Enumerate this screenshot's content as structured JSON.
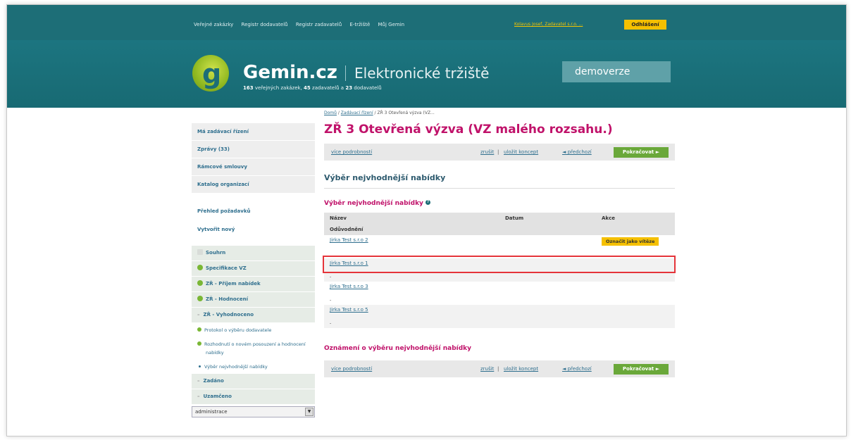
{
  "topbar": {
    "nav": [
      "Veřejné zakázky",
      "Registr dodavatelů",
      "Registr zadavatelů",
      "E-tržiště",
      "Můj Gemin"
    ],
    "user": "Kolavus Josef, Zadavatel s.r.o. ...",
    "logout": "Odhlášení"
  },
  "header": {
    "name": "Gemin.cz",
    "subtitle": "Elektronické tržiště",
    "stats_n1": "163",
    "stats_t1": " veřejných zakázek, ",
    "stats_n2": "45",
    "stats_t2": " zadavatelů a ",
    "stats_n3": "23",
    "stats_t3": " dodavatelů",
    "demo": "demoverze"
  },
  "sidebar": {
    "boxes": [
      "Má zadávací řízení",
      "Zprávy (33)",
      "Rámcové smlouvy",
      "Katalog organizací"
    ],
    "links": [
      "Přehled požadavků",
      "Vytvořit nový"
    ],
    "steps": [
      "Souhrn",
      "Specifikace VZ",
      "ZŘ - Příjem nabídek",
      "ZŘ - Hodnocení",
      "ZŘ - Vyhodnoceno"
    ],
    "substeps": [
      "Protokol o výběru dodavatele",
      "Rozhodnutí o novém posouzení a hodnocení nabídky",
      "Výběr nejvhodnější nabídky"
    ],
    "steps2": [
      "Zadáno",
      "Uzamčeno"
    ],
    "select": "administrace"
  },
  "main": {
    "breadcrumb": {
      "home": "Domů",
      "sep1": " / ",
      "proc": "Zadávací řízení",
      "sep2": " / ",
      "current": "ZŘ 3 Otevřená výzva (VZ..."
    },
    "title": "ZŘ 3 Otevřená výzva (VZ malého rozsahu.)",
    "actions": {
      "more": "více podrobností",
      "cancel": "zrušit",
      "sep": "|",
      "save": "uložit koncept",
      "prev": "◄ předchozí",
      "next": "Pokračovat ►"
    },
    "section": "Výběr nejvhodnější nabídky",
    "subsection": "Výběr nejvhodnější nabídky",
    "table": {
      "headers": {
        "name": "Název",
        "date": "Datum",
        "action": "Akce"
      },
      "subheader": "Odůvodnění",
      "rows": [
        {
          "name": "Jirka Test s.r.o 2",
          "note": "",
          "action": "Označit jako vítěze"
        },
        {
          "name": "Jirka Test s.r.o 1",
          "note": "-"
        },
        {
          "name": "Jirka Test s.r.o 3",
          "note": "-"
        },
        {
          "name": "Jirka Test s.r.o 5",
          "note": "-"
        }
      ]
    },
    "notice": "Oznámení o výběru nejvhodnější nabídky"
  },
  "colors": {
    "teal": "#1d6e77",
    "magenta": "#c0126a",
    "green": "#6aa83a",
    "yellow": "#f5c000",
    "highlight": "#e5343a"
  }
}
